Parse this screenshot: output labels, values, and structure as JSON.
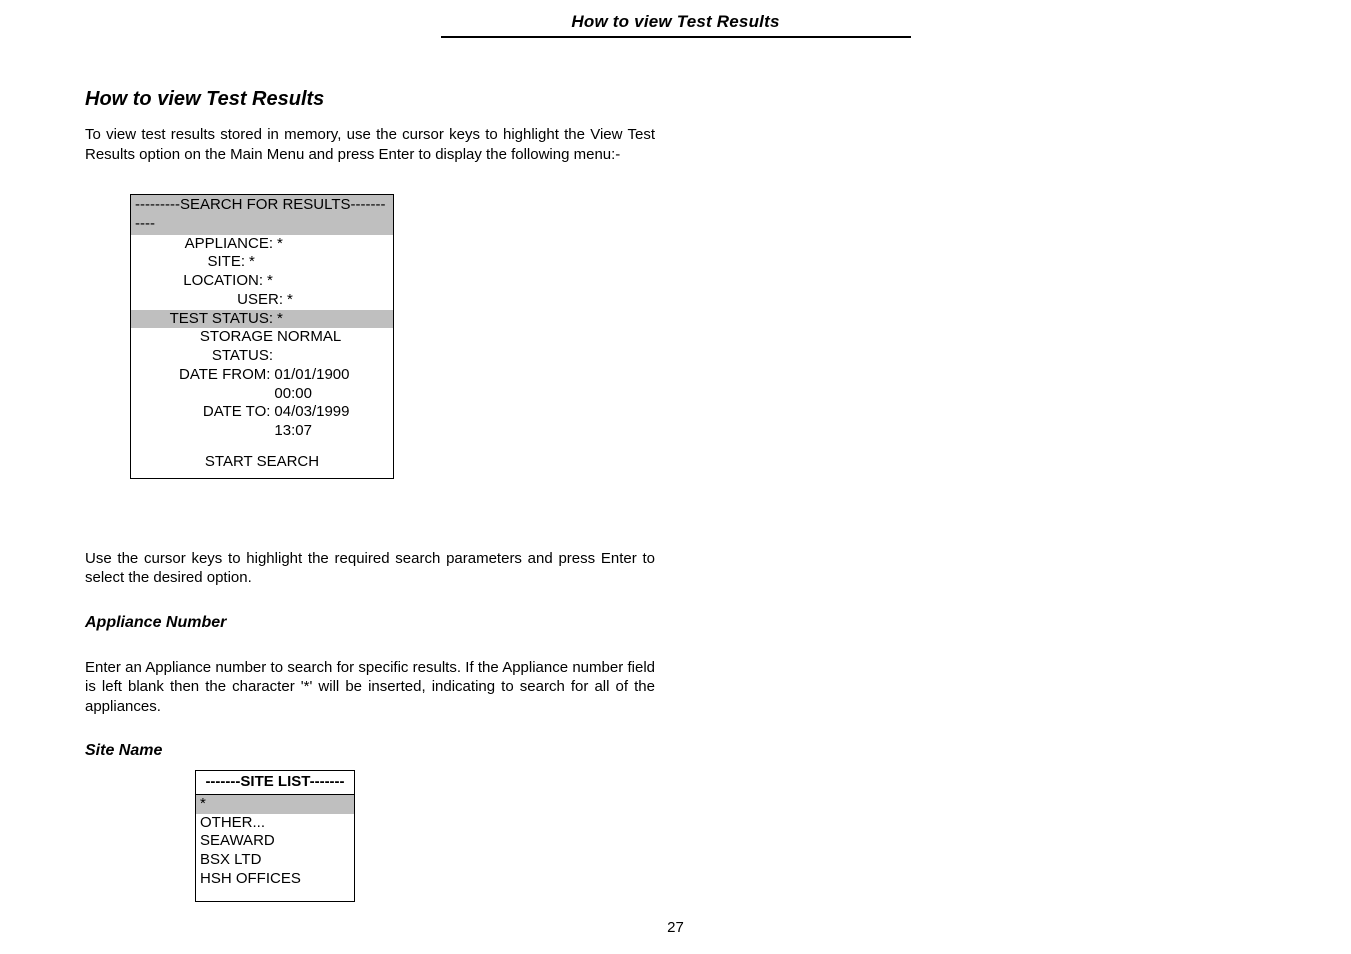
{
  "header": {
    "title": "How to view Test Results"
  },
  "section": {
    "title": "How to view Test Results",
    "intro": "To view test results stored in memory, use the cursor keys to highlight the View Test Results option on the Main Menu and press Enter  to display the following menu:-"
  },
  "search_box": {
    "header": "---------SEARCH FOR RESULTS-----------",
    "fields": {
      "appliance_label": "APPLIANCE:",
      "appliance_val": "*",
      "site_label": "SITE:",
      "site_val": "*",
      "location_label": "LOCATION:",
      "location_val": "*",
      "user_label": "USER:",
      "user_val": "*",
      "test_status_label": "TEST STATUS:",
      "test_status_val": "*",
      "storage_status_label": "STORAGE STATUS:",
      "storage_status_val": "NORMAL",
      "date_from_label": "DATE FROM:",
      "date_from_val": "01/01/1900 00:00",
      "date_to_label": "DATE TO:",
      "date_to_val": "04/03/1999 13:07"
    },
    "start": "START SEARCH"
  },
  "after_box": "Use the cursor keys to highlight the required search parameters and press Enter  to select the desired option.",
  "appliance_section": {
    "title": "Appliance Number",
    "body": "Enter an Appliance number to search for specific results.  If the Appliance number field is left blank then the character '*' will be inserted, indicating to search for all of the appliances."
  },
  "site_section": {
    "title": "Site Name",
    "list_header": "-------SITE LIST-------",
    "items": [
      "*",
      "OTHER...",
      "SEAWARD",
      "BSX LTD",
      "HSH OFFICES"
    ]
  },
  "footer": {
    "page": "27"
  }
}
